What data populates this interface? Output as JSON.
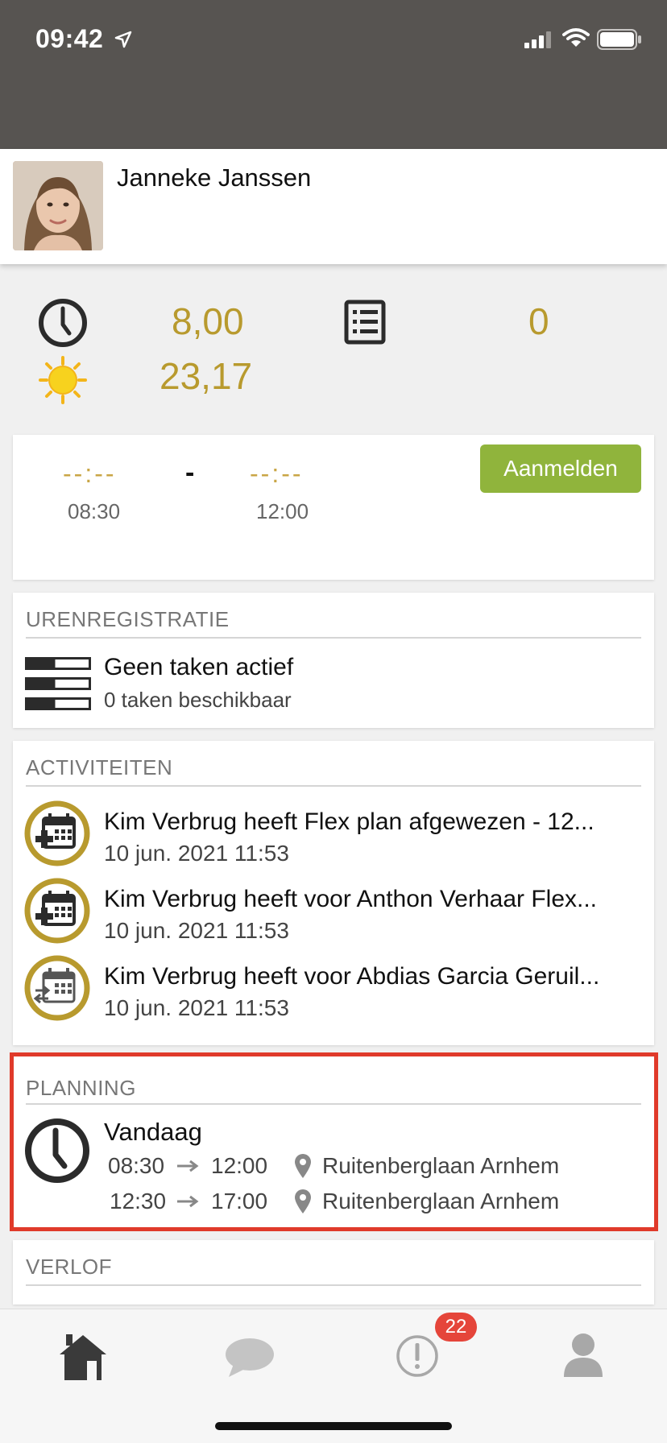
{
  "status_bar": {
    "time": "09:42"
  },
  "profile": {
    "name": "Janneke Janssen"
  },
  "stats": {
    "hours": "8,00",
    "sun_value": "23,17",
    "tasks": "0"
  },
  "clock": {
    "start_placeholder": "--:--",
    "separator": "-",
    "end_placeholder": "--:--",
    "start_time": "08:30",
    "end_time": "12:00",
    "button_label": "Aanmelden"
  },
  "urenregistratie": {
    "header": "URENREGISTRATIE",
    "title": "Geen taken actief",
    "subtitle": "0 taken beschikbaar"
  },
  "activiteiten": {
    "header": "ACTIVITEITEN",
    "items": [
      {
        "title": "Kim Verbrug heeft Flex plan afgewezen - 12...",
        "date": "10 jun. 2021 11:53",
        "icon": "calendar-add-icon"
      },
      {
        "title": "Kim Verbrug heeft voor Anthon Verhaar Flex...",
        "date": "10 jun. 2021 11:53",
        "icon": "calendar-add-icon"
      },
      {
        "title": "Kim Verbrug heeft voor Abdias Garcia Geruil...",
        "date": "10 jun. 2021 11:53",
        "icon": "calendar-swap-icon"
      }
    ]
  },
  "planning": {
    "header": "PLANNING",
    "title": "Vandaag",
    "rows": [
      {
        "start": "08:30",
        "end": "12:00",
        "location": "Ruitenberglaan Arnhem"
      },
      {
        "start": "12:30",
        "end": "17:00",
        "location": "Ruitenberglaan Arnhem"
      }
    ]
  },
  "verlof": {
    "header": "VERLOF"
  },
  "tabbar": {
    "alerts_badge": "22"
  },
  "colors": {
    "accent_gold": "#b89a2e",
    "button_green": "#90b43c",
    "highlight_red": "#e03a2a",
    "header_dark": "#575451"
  }
}
